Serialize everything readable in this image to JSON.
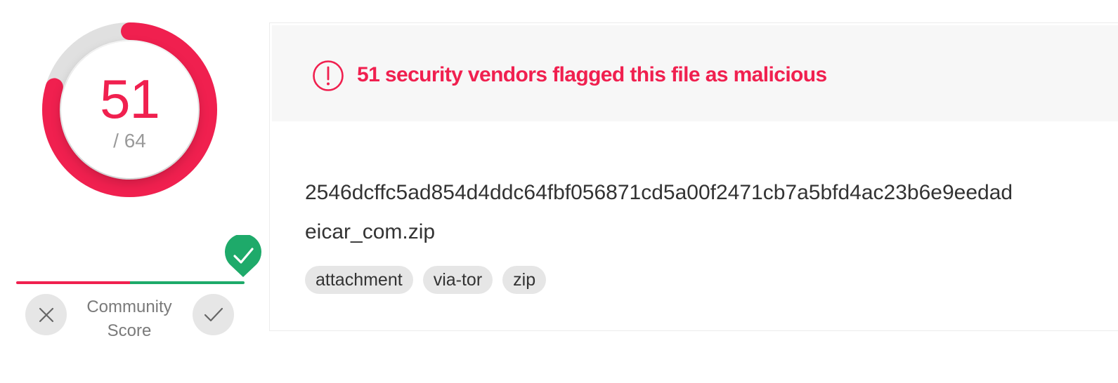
{
  "colors": {
    "malicious": "#f0204f",
    "ring_track": "#e0e0e0",
    "community_positive": "#1eaa6a",
    "community_negative": "#f0204f"
  },
  "score": {
    "detections": "51",
    "total": "/ 64",
    "fraction": 0.797
  },
  "alert": {
    "icon": "alert-circle-icon",
    "text": "51 security vendors flagged this file as malicious"
  },
  "file": {
    "hash": "2546dcffc5ad854d4ddc64fbf056871cd5a00f2471cb7a5bfd4ac23b6e9eedad",
    "name": "eicar_com.zip",
    "tags": [
      "attachment",
      "via-tor",
      "zip"
    ]
  },
  "community": {
    "label_line1": "Community",
    "label_line2": "Score",
    "downvote_icon": "close-icon",
    "upvote_icon": "check-icon",
    "marker_icon": "check-shield-icon",
    "position": 1.0
  }
}
